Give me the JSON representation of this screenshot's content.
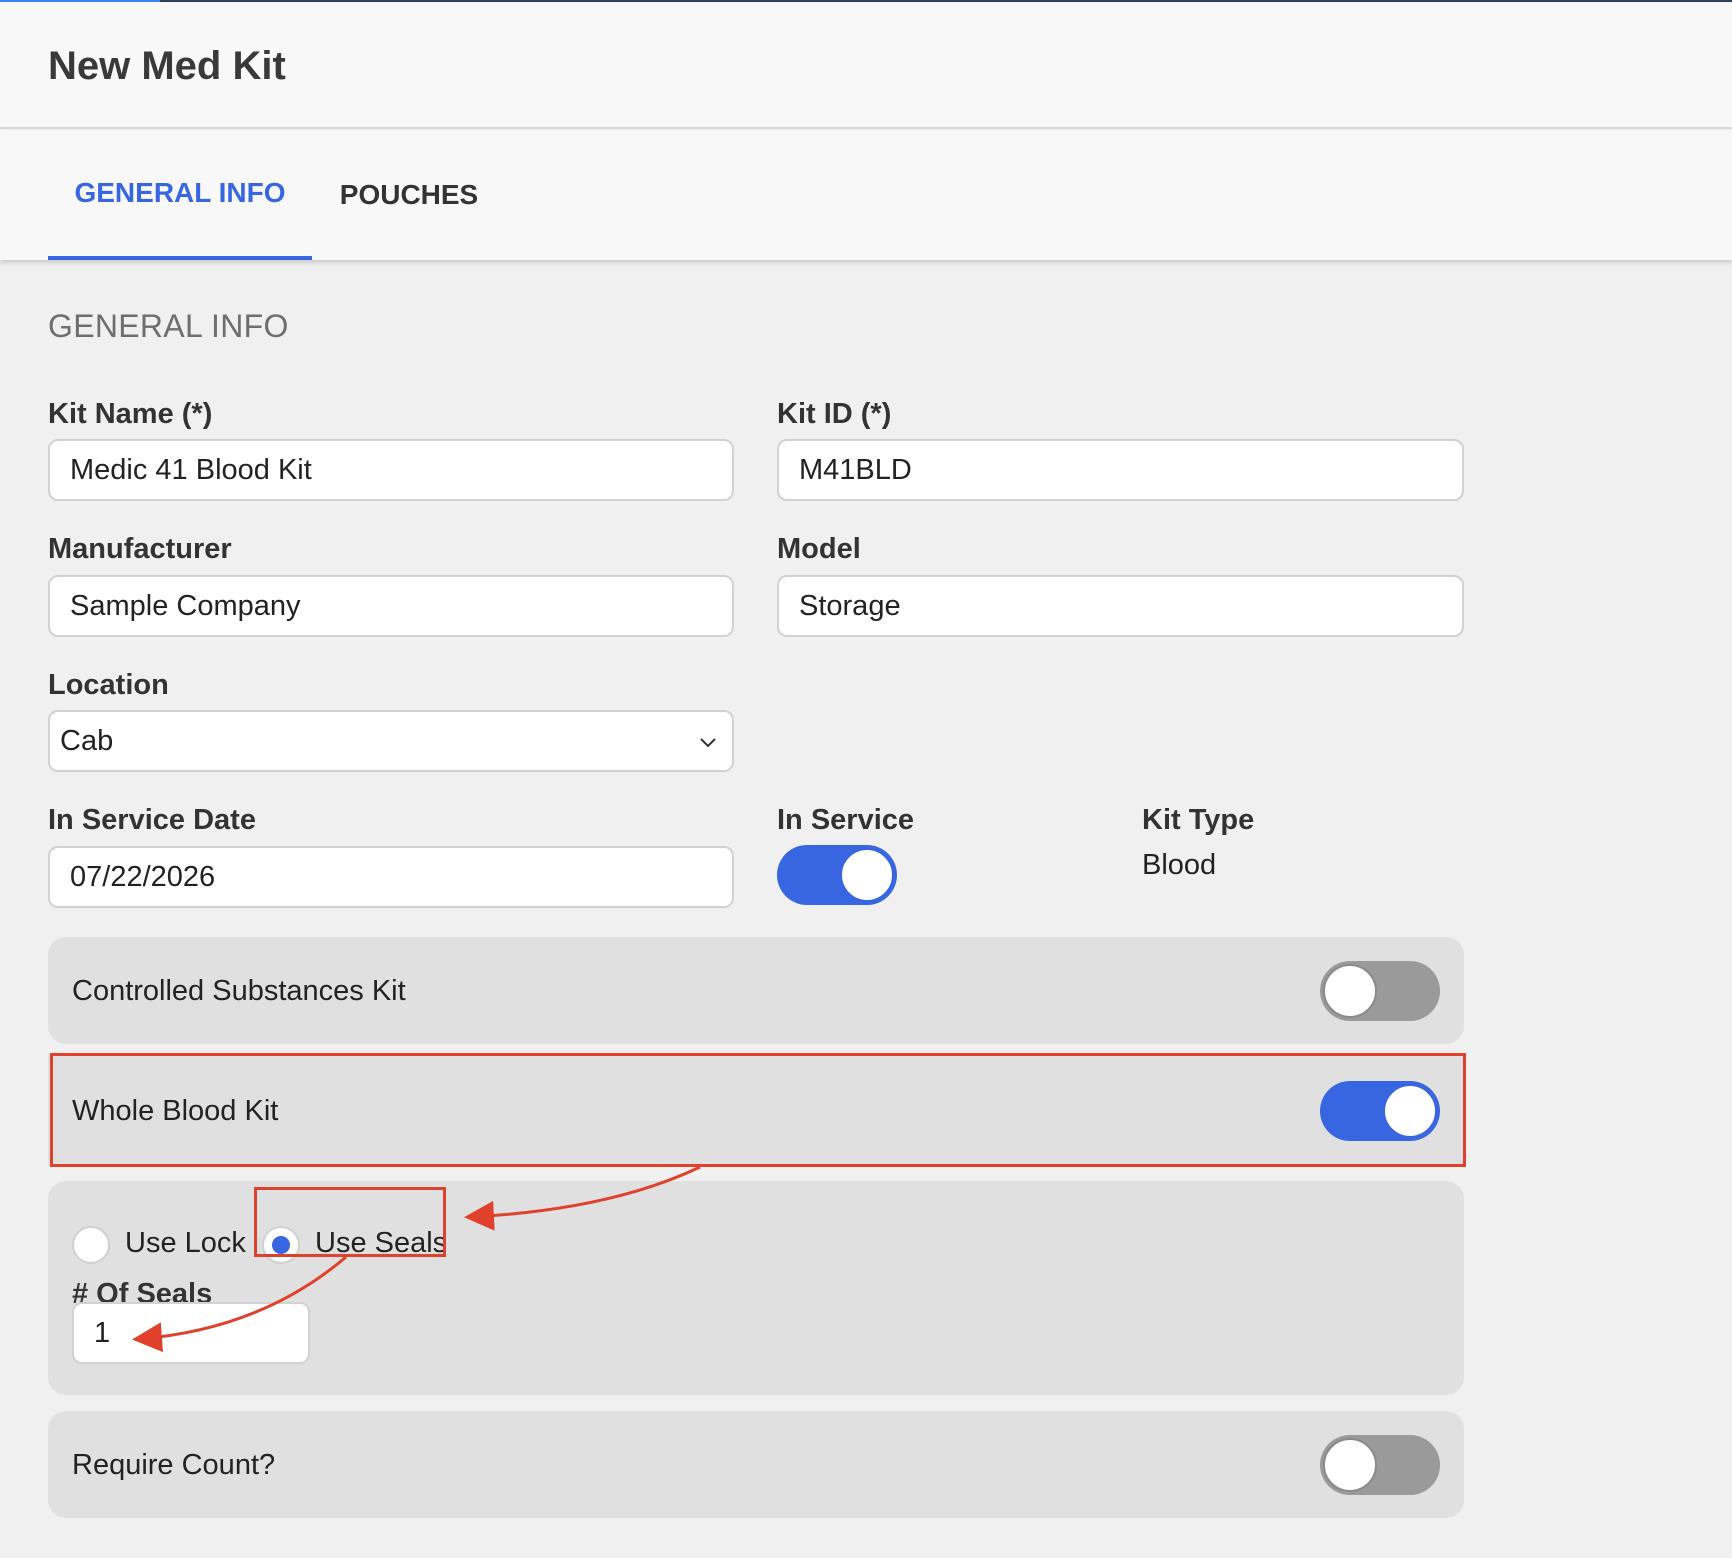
{
  "header": {
    "title": "New Med Kit"
  },
  "tabs": [
    {
      "label": "GENERAL INFO",
      "active": true
    },
    {
      "label": "POUCHES",
      "active": false
    }
  ],
  "section": {
    "title": "GENERAL INFO"
  },
  "fields": {
    "kit_name": {
      "label": "Kit Name (*)",
      "value": "Medic 41 Blood Kit"
    },
    "kit_id": {
      "label": "Kit ID (*)",
      "value": "M41BLD"
    },
    "manufacturer": {
      "label": "Manufacturer",
      "value": "Sample Company"
    },
    "model": {
      "label": "Model",
      "value": "Storage"
    },
    "location": {
      "label": "Location",
      "value": "Cab"
    },
    "in_service_date": {
      "label": "In Service Date",
      "value": "07/22/2026"
    },
    "in_service": {
      "label": "In Service",
      "on": true
    },
    "kit_type": {
      "label": "Kit Type",
      "value": "Blood"
    }
  },
  "panels": {
    "controlled_substances": {
      "label": "Controlled Substances Kit",
      "on": false
    },
    "whole_blood": {
      "label": "Whole Blood Kit",
      "on": true
    },
    "seal_options": {
      "use_lock": {
        "label": "Use Lock",
        "selected": false
      },
      "use_seals": {
        "label": "Use Seals",
        "selected": true
      },
      "num_seals": {
        "label": "# Of Seals",
        "value": "1"
      }
    },
    "require_count": {
      "label": "Require Count?",
      "on": false
    }
  },
  "colors": {
    "accent": "#3866e0",
    "annotation": "#e0412d",
    "toggle_off": "#9a9a9a"
  }
}
